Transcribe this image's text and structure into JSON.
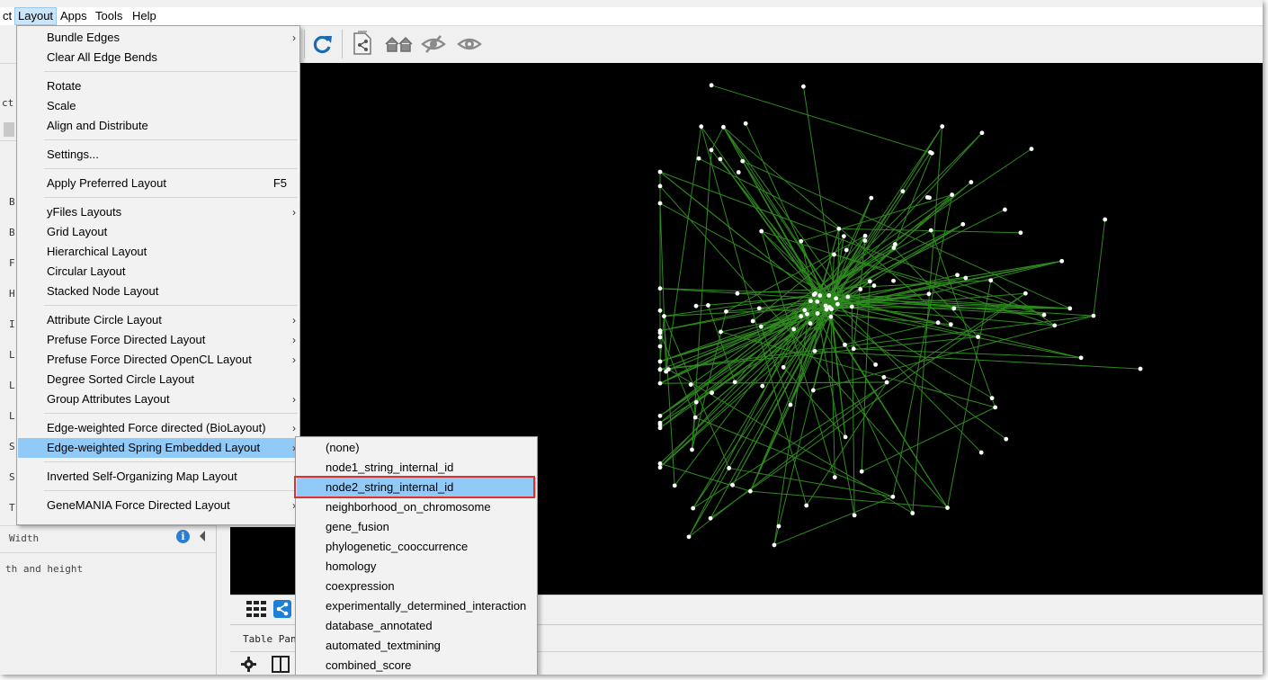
{
  "menubar": {
    "items": [
      "ct",
      "Layout",
      "Apps",
      "Tools",
      "Help"
    ],
    "active": "Layout"
  },
  "layout_menu": {
    "items": [
      {
        "label": "Bundle Edges",
        "submenu": true
      },
      {
        "label": "Clear All Edge Bends"
      },
      {
        "label": "Rotate"
      },
      {
        "label": "Scale"
      },
      {
        "label": "Align and Distribute"
      },
      {
        "label": "Settings..."
      },
      {
        "label": "Apply Preferred Layout",
        "accelerator": "F5"
      },
      {
        "label": "yFiles Layouts",
        "submenu": true
      },
      {
        "label": "Grid Layout"
      },
      {
        "label": "Hierarchical Layout"
      },
      {
        "label": "Circular Layout"
      },
      {
        "label": "Stacked Node Layout"
      },
      {
        "label": "Attribute Circle Layout",
        "submenu": true
      },
      {
        "label": "Prefuse Force Directed Layout",
        "submenu": true
      },
      {
        "label": "Prefuse Force Directed OpenCL Layout",
        "submenu": true
      },
      {
        "label": "Degree Sorted Circle Layout"
      },
      {
        "label": "Group Attributes Layout",
        "submenu": true
      },
      {
        "label": "Edge-weighted Force directed (BioLayout)",
        "submenu": true
      },
      {
        "label": "Edge-weighted Spring Embedded Layout",
        "submenu": true,
        "highlighted": true
      },
      {
        "label": "Inverted Self-Organizing Map Layout"
      },
      {
        "label": "GeneMANIA Force Directed Layout",
        "submenu": true
      }
    ]
  },
  "edge_weight_submenu": {
    "items": [
      {
        "label": "(none)"
      },
      {
        "label": "node1_string_internal_id"
      },
      {
        "label": "node2_string_internal_id",
        "highlighted": true
      },
      {
        "label": "neighborhood_on_chromosome"
      },
      {
        "label": "gene_fusion"
      },
      {
        "label": "phylogenetic_cooccurrence"
      },
      {
        "label": "homology"
      },
      {
        "label": "coexpression"
      },
      {
        "label": "experimentally_determined_interaction"
      },
      {
        "label": "database_annotated"
      },
      {
        "label": "automated_textmining"
      },
      {
        "label": "combined_score"
      }
    ]
  },
  "left_panel": {
    "row_letters": [
      "ct",
      "B",
      "B",
      "F",
      "H",
      "I",
      "L",
      "L",
      "L",
      "S",
      "S",
      "T"
    ],
    "width_label": "Width",
    "width_desc": "th and height",
    "info_icon": "info-icon"
  },
  "table_panel": {
    "label": "Table Pane"
  },
  "toolbar": {
    "icons": [
      "refresh-icon",
      "export-network-icon",
      "home-icon",
      "hide-icon",
      "show-icon"
    ]
  },
  "bottom_icons": [
    "grid-icon",
    "share-icon",
    "gear-icon",
    "panel-icon"
  ],
  "colors": {
    "canvas_bg": "#000000",
    "edge": "#2f8a1f",
    "node": "#ffffff",
    "menu_highlight": "#91c9f7",
    "red_box": "#e0312c",
    "toolbar_icon": "#1e6ab0"
  }
}
